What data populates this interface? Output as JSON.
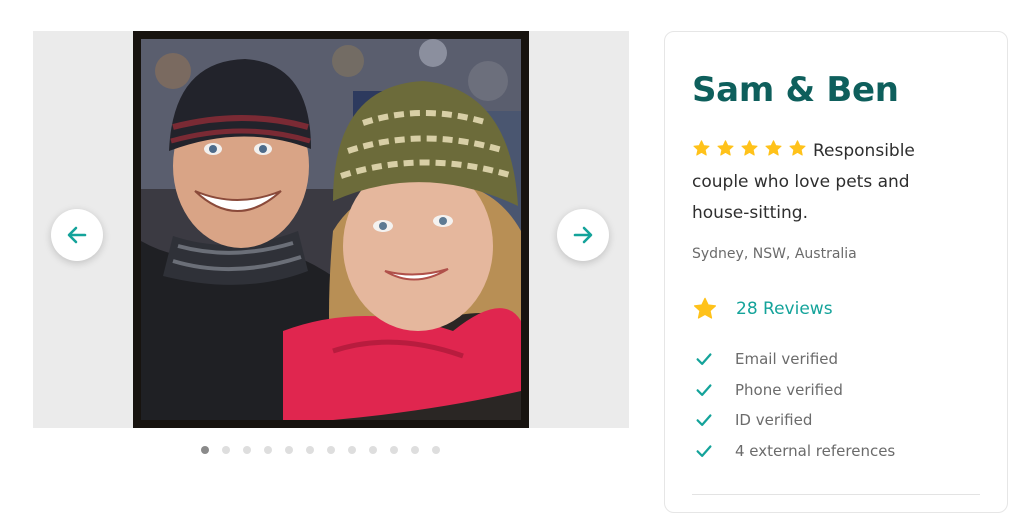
{
  "carousel": {
    "prev_icon": "arrow-left-icon",
    "next_icon": "arrow-right-icon",
    "accent_color": "#14a39a",
    "slide_count": 12,
    "active_slide": 1
  },
  "profile": {
    "name": "Sam & Ben",
    "rating_stars": 5,
    "star_color": "#ffc21a",
    "bio": "Responsible couple who love pets and house-sitting.",
    "location": "Sydney, NSW, Australia",
    "reviews_label": "28 Reviews",
    "name_color": "#0e5f5c",
    "verifications": [
      {
        "label": "Email verified"
      },
      {
        "label": "Phone verified"
      },
      {
        "label": "ID verified"
      },
      {
        "label": "4 external references"
      }
    ]
  }
}
